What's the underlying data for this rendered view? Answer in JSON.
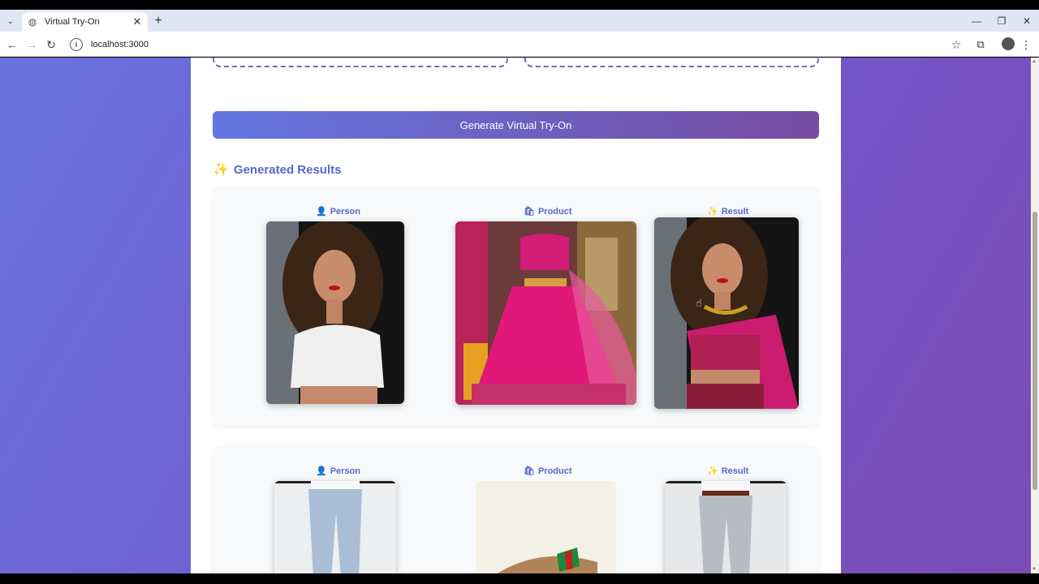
{
  "browser": {
    "tab_title": "Virtual Try-On",
    "url": "localhost:3000",
    "icons": {
      "tab_menu": "chevron-down-icon",
      "favicon": "globe-icon",
      "tab_close": "close-icon",
      "new_tab": "plus-icon",
      "minimize": "minimize-icon",
      "restore": "restore-icon",
      "close_window": "close-icon",
      "back": "back-arrow-icon",
      "forward": "forward-arrow-icon",
      "reload": "reload-icon",
      "site_info": "info-icon",
      "bookmark": "star-icon",
      "extensions": "puzzle-icon",
      "menu": "kebab-menu-icon"
    },
    "glyphs": {
      "tab_menu": "⌄",
      "favicon": "◍",
      "tab_close": "✕",
      "new_tab": "+",
      "minimize": "—",
      "restore": "❐",
      "close_window": "✕",
      "back": "←",
      "forward": "→",
      "reload": "↻",
      "site_info": "i",
      "bookmark": "☆",
      "extensions": "⧉",
      "menu": "⋮"
    }
  },
  "app": {
    "generate_button": "Generate Virtual Try-On",
    "results_title": "Generated Results",
    "results_icon": "✨",
    "columns": {
      "person": {
        "label": "Person",
        "icon": "👤"
      },
      "product": {
        "label": "Product",
        "icon": "🛍"
      },
      "result": {
        "label": "Result",
        "icon": "✨"
      }
    }
  },
  "colors": {
    "accent": "#5a67c8",
    "gradient_start": "#6377e0",
    "gradient_end": "#764ba2"
  }
}
